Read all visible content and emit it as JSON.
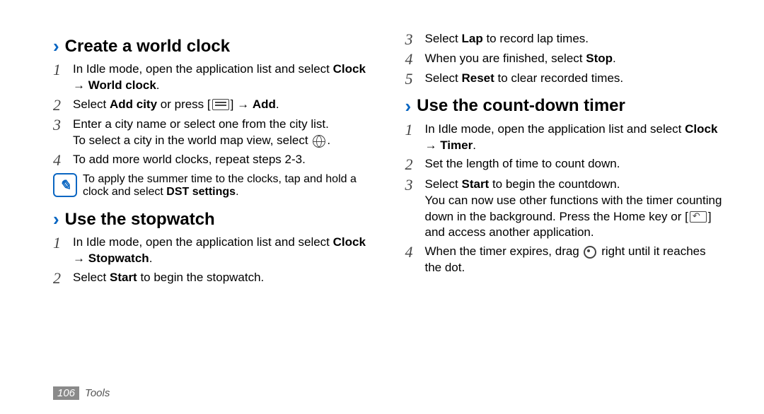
{
  "page_number": "106",
  "section": "Tools",
  "left": {
    "h_world": "Create a world clock",
    "w1_a": "In Idle mode, open the application list and select ",
    "w1_b": "Clock",
    "w1_c": " → ",
    "w1_d": "World clock",
    "w1_e": ".",
    "w2_a": "Select ",
    "w2_b": "Add city",
    "w2_c": " or press [",
    "w2_d": "] → ",
    "w2_e": "Add",
    "w2_f": ".",
    "w3_a": "Enter a city name or select one from the city list.",
    "w3_b": "To select a city in the world map view, select ",
    "w3_c": ".",
    "w4": "To add more world clocks, repeat steps 2-3.",
    "note_a": "To apply the summer time to the clocks, tap and hold a clock and select ",
    "note_b": "DST settings",
    "note_c": ".",
    "h_stop": "Use the stopwatch",
    "s1_a": "In Idle mode, open the application list and select ",
    "s1_b": "Clock",
    "s1_c": " → ",
    "s1_d": "Stopwatch",
    "s1_e": ".",
    "s2_a": "Select ",
    "s2_b": "Start",
    "s2_c": " to begin the stopwatch."
  },
  "right": {
    "s3_a": "Select ",
    "s3_b": "Lap",
    "s3_c": " to record lap times.",
    "s4_a": "When you are finished, select ",
    "s4_b": "Stop",
    "s4_c": ".",
    "s5_a": "Select ",
    "s5_b": "Reset",
    "s5_c": " to clear recorded times.",
    "h_timer": "Use the count-down timer",
    "t1_a": "In Idle mode, open the application list and select ",
    "t1_b": "Clock",
    "t1_c": " → ",
    "t1_d": "Timer",
    "t1_e": ".",
    "t2": "Set the length of time to count down.",
    "t3_a": "Select ",
    "t3_b": "Start",
    "t3_c": " to begin the countdown.",
    "t3_d": "You can now use other functions with the timer counting down in the background. Press the Home key or [",
    "t3_e": "] and access another application.",
    "t4_a": "When the timer expires, drag ",
    "t4_b": " right until it reaches the dot."
  }
}
